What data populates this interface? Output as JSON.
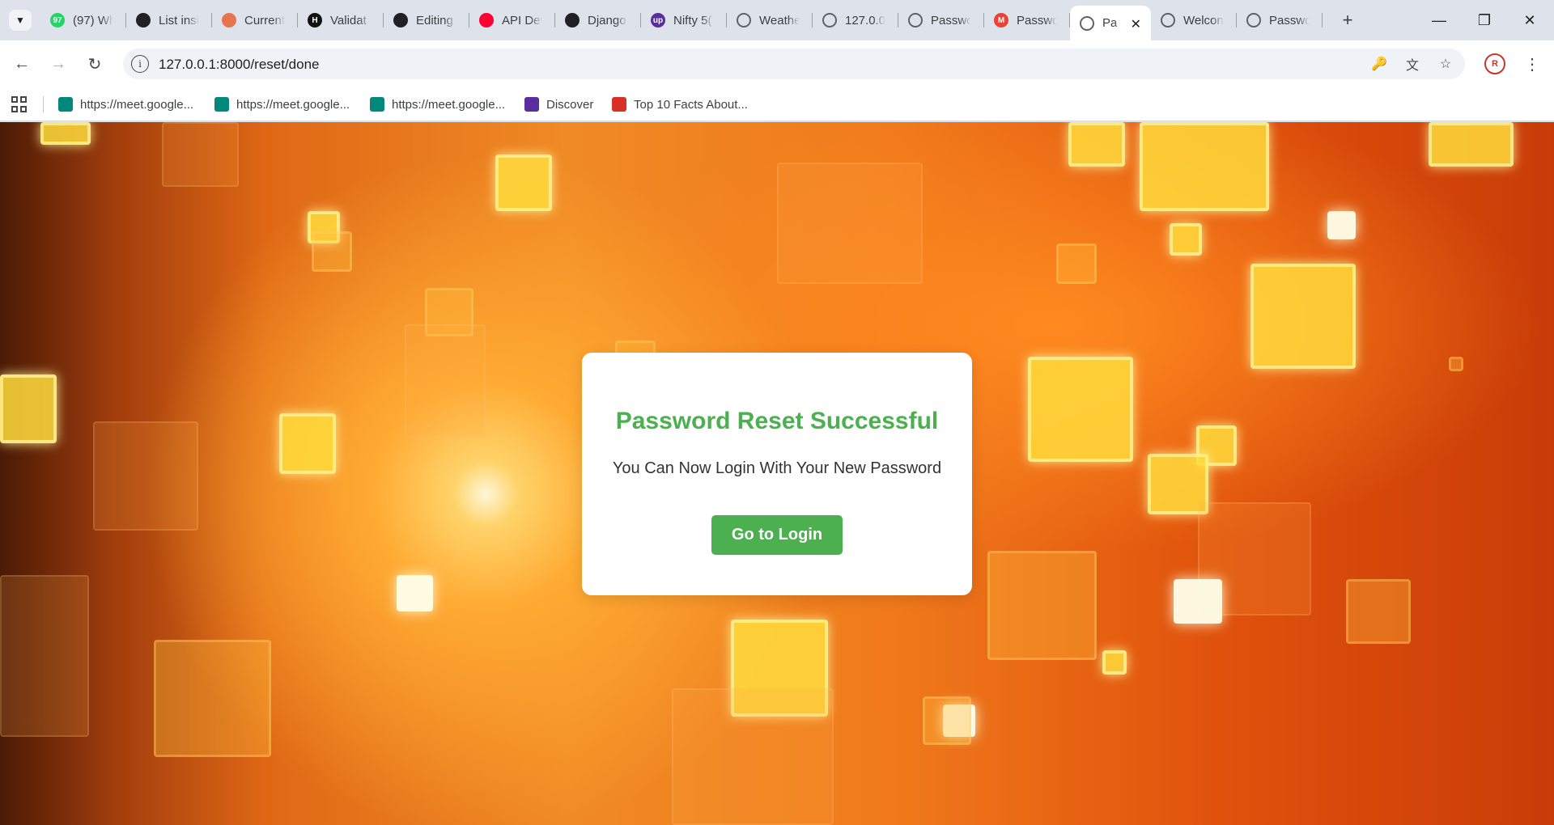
{
  "browser": {
    "tabs": [
      {
        "title": "(97) Wh",
        "favicon": "whatsapp-icon",
        "color": "#25d366",
        "badge": "97"
      },
      {
        "title": "List insi",
        "favicon": "chatgpt-icon",
        "color": "#202124"
      },
      {
        "title": "Current",
        "favicon": "cloud-icon",
        "color": "#e8744f"
      },
      {
        "title": "Validat",
        "favicon": "hackerrank-icon",
        "color": "#111111",
        "badge": "H"
      },
      {
        "title": "Editing",
        "favicon": "github-icon",
        "color": "#202124"
      },
      {
        "title": "API Dev",
        "favicon": "youtube-icon",
        "color": "#ff0033"
      },
      {
        "title": "Django",
        "favicon": "chatgpt-icon",
        "color": "#202124"
      },
      {
        "title": "Nifty 5(",
        "favicon": "upstox-icon",
        "color": "#5a2d9c",
        "badge": "up"
      },
      {
        "title": "Weathe",
        "favicon": "globe-icon",
        "color": "#5f6368"
      },
      {
        "title": "127.0.0",
        "favicon": "globe-icon",
        "color": "#5f6368"
      },
      {
        "title": "Passwo",
        "favicon": "globe-icon",
        "color": "#5f6368"
      },
      {
        "title": "Passwo",
        "favicon": "gmail-icon",
        "color": "#ea4335",
        "badge": "M"
      },
      {
        "title": "Pa",
        "favicon": "globe-icon",
        "color": "#5f6368",
        "active": true
      },
      {
        "title": "Welcon",
        "favicon": "globe-icon",
        "color": "#5f6368"
      },
      {
        "title": "Passwo",
        "favicon": "globe-icon",
        "color": "#5f6368"
      }
    ],
    "url": "127.0.0.1:8000/reset/done",
    "bookmarks": [
      {
        "label": "https://meet.google...",
        "favicon": "google-meet-icon"
      },
      {
        "label": "https://meet.google...",
        "favicon": "google-meet-icon"
      },
      {
        "label": "https://meet.google...",
        "favicon": "google-meet-icon"
      },
      {
        "label": "Discover",
        "favicon": "upstox-icon"
      },
      {
        "label": "Top 10 Facts About...",
        "favicon": "facts-icon"
      }
    ]
  },
  "page": {
    "title": "Password Reset Successful",
    "message": "You Can Now Login With Your New Password",
    "button_label": "Go to Login",
    "accent_color": "#4caf50"
  }
}
